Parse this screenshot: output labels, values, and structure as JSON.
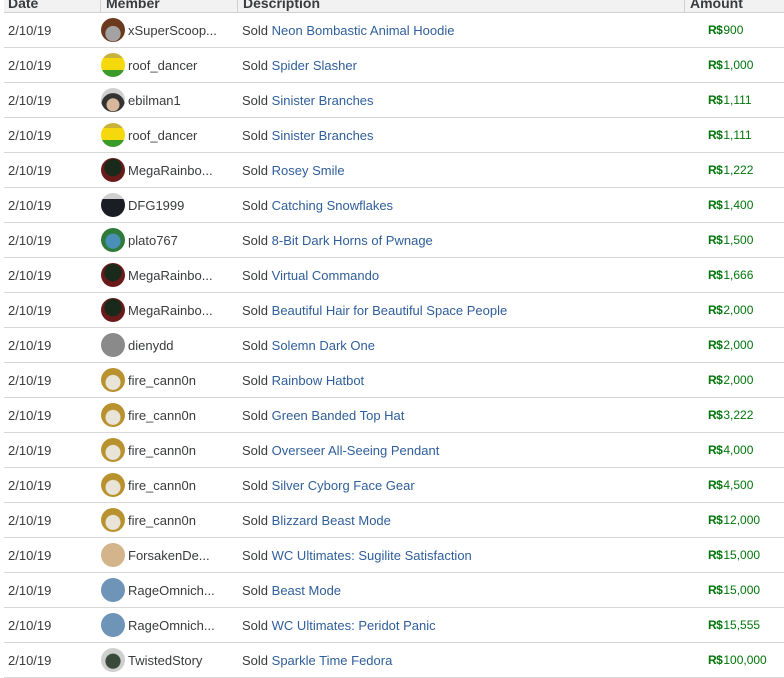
{
  "table": {
    "headers": {
      "date": "Date",
      "member": "Member",
      "description": "Description",
      "amount": "Amount"
    },
    "currency_symbol": "R$",
    "sold_prefix": "Sold",
    "rows": [
      {
        "date": "2/10/19",
        "member": "xSuperScoop...",
        "avatar": "avatar-brown-hair",
        "item": "Neon Bombastic Animal Hoodie",
        "amount": "900"
      },
      {
        "date": "2/10/19",
        "member": "roof_dancer",
        "avatar": "avatar-yellow-green",
        "item": "Spider Slasher",
        "amount": "1,000"
      },
      {
        "date": "2/10/19",
        "member": "ebilman1",
        "avatar": "avatar-dark-hair",
        "item": "Sinister Branches",
        "amount": "1,111"
      },
      {
        "date": "2/10/19",
        "member": "roof_dancer",
        "avatar": "avatar-yellow-green",
        "item": "Sinister Branches",
        "amount": "1,111"
      },
      {
        "date": "2/10/19",
        "member": "MegaRainbo...",
        "avatar": "avatar-dark-red",
        "item": "Rosey Smile",
        "amount": "1,222"
      },
      {
        "date": "2/10/19",
        "member": "DFG1999",
        "avatar": "avatar-black-horns",
        "item": "Catching Snowflakes",
        "amount": "1,400"
      },
      {
        "date": "2/10/19",
        "member": "plato767",
        "avatar": "avatar-blue-green",
        "item": "8-Bit Dark Horns of Pwnage",
        "amount": "1,500"
      },
      {
        "date": "2/10/19",
        "member": "MegaRainbo...",
        "avatar": "avatar-dark-red",
        "item": "Virtual Commando",
        "amount": "1,666"
      },
      {
        "date": "2/10/19",
        "member": "MegaRainbo...",
        "avatar": "avatar-dark-red",
        "item": "Beautiful Hair for Beautiful Space People",
        "amount": "2,000"
      },
      {
        "date": "2/10/19",
        "member": "dienydd",
        "avatar": "avatar-grey",
        "item": "Solemn Dark One",
        "amount": "2,000"
      },
      {
        "date": "2/10/19",
        "member": "fire_cann0n",
        "avatar": "avatar-sunglasses",
        "item": "Rainbow Hatbot",
        "amount": "2,000"
      },
      {
        "date": "2/10/19",
        "member": "fire_cann0n",
        "avatar": "avatar-sunglasses",
        "item": "Green Banded Top Hat",
        "amount": "3,222"
      },
      {
        "date": "2/10/19",
        "member": "fire_cann0n",
        "avatar": "avatar-sunglasses",
        "item": "Overseer All-Seeing Pendant",
        "amount": "4,000"
      },
      {
        "date": "2/10/19",
        "member": "fire_cann0n",
        "avatar": "avatar-sunglasses",
        "item": "Silver Cyborg Face Gear",
        "amount": "4,500"
      },
      {
        "date": "2/10/19",
        "member": "fire_cann0n",
        "avatar": "avatar-sunglasses",
        "item": "Blizzard Beast Mode",
        "amount": "12,000"
      },
      {
        "date": "2/10/19",
        "member": "ForsakenDe...",
        "avatar": "avatar-tan",
        "item": "WC Ultimates: Sugilite Satisfaction",
        "amount": "15,000"
      },
      {
        "date": "2/10/19",
        "member": "RageOmnich...",
        "avatar": "avatar-blue",
        "item": "Beast Mode",
        "amount": "15,000"
      },
      {
        "date": "2/10/19",
        "member": "RageOmnich...",
        "avatar": "avatar-blue",
        "item": "WC Ultimates: Peridot Panic",
        "amount": "15,555"
      },
      {
        "date": "2/10/19",
        "member": "TwistedStory",
        "avatar": "avatar-dark-tree",
        "item": "Sparkle Time Fedora",
        "amount": "100,000"
      }
    ]
  },
  "colors": {
    "link": "#2f5e9b",
    "amount_green": "#02760b",
    "text": "#393b3d",
    "header_bg": "#f2f2f2",
    "divider": "#d8d8d8"
  }
}
